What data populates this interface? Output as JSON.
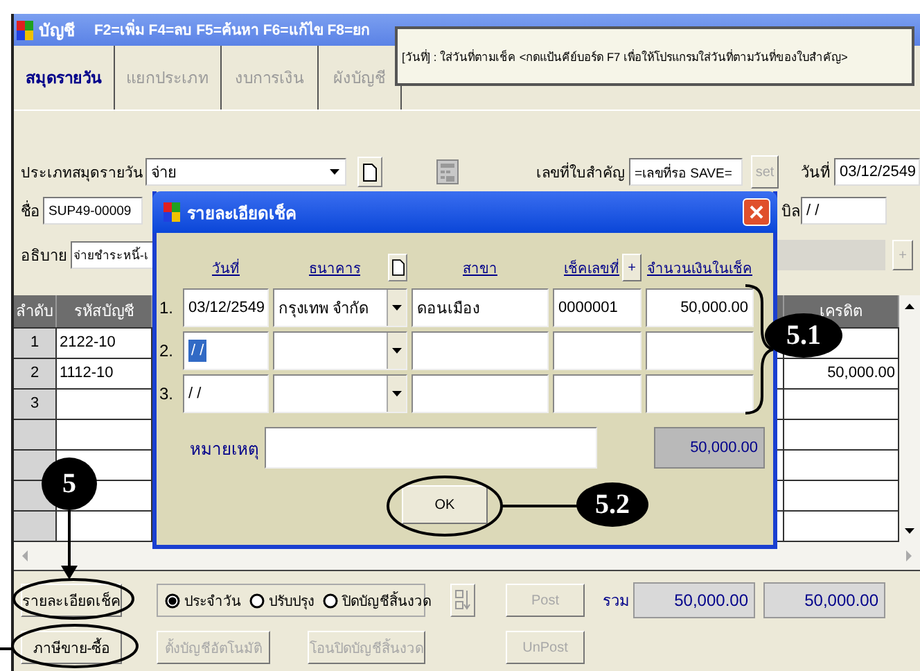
{
  "window": {
    "title": "บัญชี",
    "shortcuts": "F2=เพิ่ม F4=ลบ F5=ค้นหา F6=แก้ไข F8=ยก"
  },
  "tooltip": "[วันที่] : ใส่วันที่ตามเช็ค <กดแป้นคีย์บอร์ด F7 เพื่อให้โปรแกรมใส่วันที่ตามวันที่ของใบสำคัญ>",
  "tabs": [
    {
      "label": "สมุดรายวัน",
      "selected": true
    },
    {
      "label": "แยกประเภท",
      "selected": false
    },
    {
      "label": "งบการเงิน",
      "selected": false
    },
    {
      "label": "ผังบัญชี",
      "selected": false
    }
  ],
  "form": {
    "journal_type_label": "ประเภทสมุดรายวัน",
    "journal_type": "จ่าย",
    "voucher_label": "เลขที่ใบสำคัญ",
    "voucher_no": "=เลขที่รอ SAVE=",
    "set_button": {
      "label": "set",
      "disabled": true
    },
    "date_label": "วันที่",
    "date": "03/12/2549",
    "name_label": "ชื่อ",
    "name": "SUP49-00009",
    "bill_label": "บิล",
    "bill": "/ /",
    "description_label": "อธิบาย",
    "description": "จ่ายชำระหนี้-เ",
    "plus_button": {
      "label": "+",
      "disabled": true
    }
  },
  "table": {
    "columns": [
      "ลำดับ",
      "รหัสบัญชี",
      "เครดิต"
    ],
    "rows": [
      {
        "no": "1",
        "account": "2122-10",
        "credit": ""
      },
      {
        "no": "2",
        "account": "1112-10",
        "credit": "50,000.00"
      },
      {
        "no": "3",
        "account": "",
        "credit": ""
      }
    ]
  },
  "bottom": {
    "cheque_button": "รายละเอียดเช็ค",
    "tax_button": "ภาษีขาย-ซื้อ",
    "radios": [
      {
        "label": "ประจำวัน",
        "selected": true
      },
      {
        "label": "ปรับปรุง",
        "selected": false
      },
      {
        "label": "ปิดบัญชีสิ้นงวด",
        "selected": false
      }
    ],
    "post_button": {
      "label": "Post",
      "disabled": true
    },
    "unpost_button": {
      "label": "UnPost",
      "disabled": true
    },
    "auto_button": {
      "label": "ตั้งบัญชีอัตโนมัติ",
      "disabled": true
    },
    "transfer_button": {
      "label": "โอนปิดบัญชีสิ้นงวด",
      "disabled": true
    },
    "total_label": "รวม",
    "totals": [
      "50,000.00",
      "50,000.00"
    ]
  },
  "dialog": {
    "title": "รายละเอียดเช็ค",
    "columns": [
      "วันที่",
      "ธนาคาร",
      "สาขา",
      "เช็คเลขที่",
      "จำนวนเงินในเช็ค"
    ],
    "add_button": "+",
    "rows": [
      {
        "number": "1.",
        "date": "03/12/2549",
        "bank": "กรุงเทพ จำกัด",
        "branch": "ดอนเมือง",
        "cheque_no": "0000001",
        "amount": "50,000.00",
        "selected": false
      },
      {
        "number": "2.",
        "date": "/ /",
        "bank": "",
        "branch": "",
        "cheque_no": "",
        "amount": "",
        "selected": true
      },
      {
        "number": "3.",
        "date": "/ /",
        "bank": "",
        "branch": "",
        "cheque_no": "",
        "amount": "",
        "selected": false
      }
    ],
    "remark_label": "หมายเหตุ",
    "total": "50,000.00",
    "ok_button": "OK"
  },
  "annotations": [
    {
      "label": "5"
    },
    {
      "label": "5.1"
    },
    {
      "label": "5.2"
    }
  ]
}
